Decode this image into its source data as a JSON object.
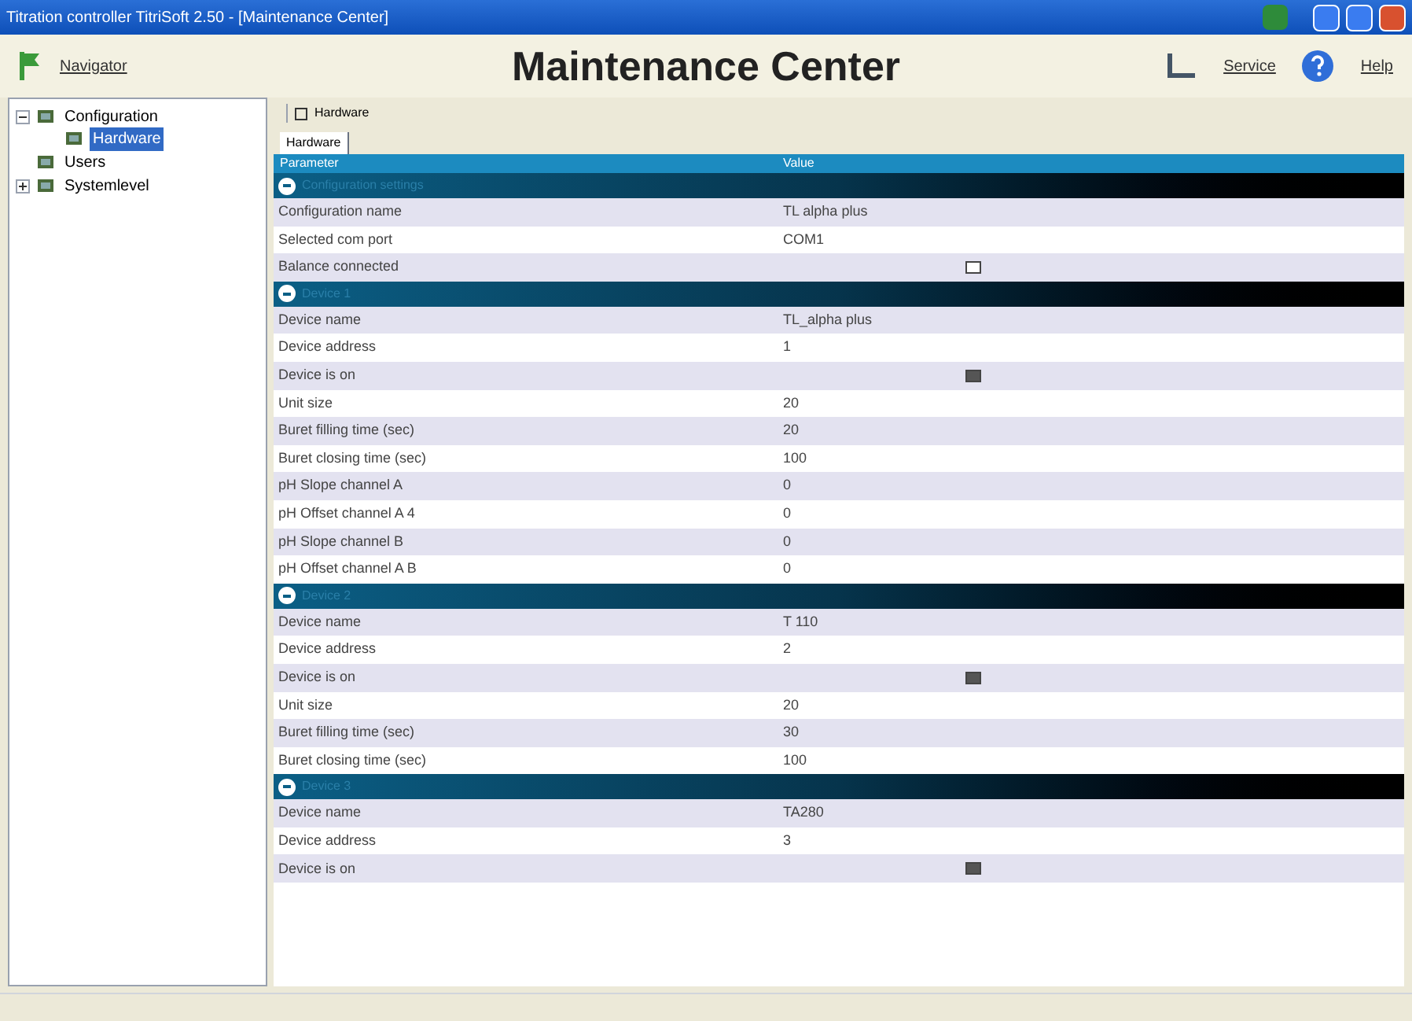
{
  "window": {
    "title": "Titration controller TitriSoft 2.50 - [Maintenance Center]"
  },
  "header": {
    "navigator": "Navigator",
    "title": "Maintenance Center",
    "links": [
      "Service",
      "Help"
    ]
  },
  "tree": [
    {
      "label": "Configuration",
      "expanded": true,
      "selected": false,
      "children": [
        {
          "label": "Hardware",
          "selected": true
        }
      ]
    },
    {
      "label": "Users",
      "selected": false
    },
    {
      "label": "Systemlevel",
      "expanded": false,
      "selected": false
    }
  ],
  "toolbar": {
    "button": "Hardware"
  },
  "tabs": [
    {
      "label": "Hardware",
      "selected": true
    }
  ],
  "table": {
    "columns": [
      "Parameter",
      "Value"
    ],
    "groups": [
      {
        "title": "Configuration settings",
        "rows": [
          {
            "kind": "text",
            "name": "Configuration name",
            "value": "TL alpha plus"
          },
          {
            "kind": "text",
            "name": "Selected com port",
            "value": "COM1"
          },
          {
            "kind": "checkbox",
            "name": "Balance connected",
            "checked": false
          }
        ]
      },
      {
        "title": "Device 1",
        "rows": [
          {
            "kind": "text",
            "name": "Device name",
            "value": "TL_alpha plus"
          },
          {
            "kind": "text",
            "name": "Device address",
            "value": "1"
          },
          {
            "kind": "checkbox",
            "name": "Device is on",
            "checked": true
          },
          {
            "kind": "text",
            "name": "Unit size",
            "value": "20"
          },
          {
            "kind": "text",
            "name": "Buret filling time (sec)",
            "value": "20"
          },
          {
            "kind": "text",
            "name": "Buret closing time (sec)",
            "value": "100"
          },
          {
            "kind": "text",
            "name": "pH Slope channel A",
            "value": "0"
          },
          {
            "kind": "text",
            "name": "pH Offset channel A 4",
            "value": "0"
          },
          {
            "kind": "text",
            "name": "pH Slope channel B",
            "value": "0"
          },
          {
            "kind": "text",
            "name": "pH Offset channel A B",
            "value": "0"
          }
        ]
      },
      {
        "title": "Device 2",
        "rows": [
          {
            "kind": "text",
            "name": "Device name",
            "value": "T 110"
          },
          {
            "kind": "text",
            "name": "Device address",
            "value": "2"
          },
          {
            "kind": "checkbox",
            "name": "Device is on",
            "checked": true
          },
          {
            "kind": "text",
            "name": "Unit size",
            "value": "20"
          },
          {
            "kind": "text",
            "name": "Buret filling time (sec)",
            "value": "30"
          },
          {
            "kind": "text",
            "name": "Buret closing time (sec)",
            "value": "100"
          }
        ]
      },
      {
        "title": "Device 3",
        "rows": [
          {
            "kind": "text",
            "name": "Device name",
            "value": "TA280"
          },
          {
            "kind": "text",
            "name": "Device address",
            "value": "3"
          },
          {
            "kind": "checkbox",
            "name": "Device is on",
            "checked": true
          }
        ]
      }
    ]
  }
}
